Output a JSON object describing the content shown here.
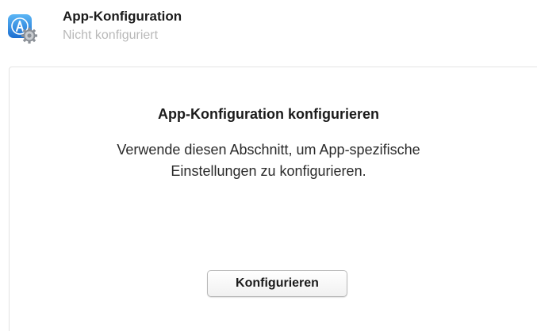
{
  "header": {
    "icon": "app-store-gear-icon",
    "title": "App-Konfiguration",
    "subtitle": "Nicht konfiguriert"
  },
  "panel": {
    "title": "App-Konfiguration konfigurieren",
    "description_line1": "Verwende diesen Abschnitt, um App-spezifische",
    "description_line2": "Einstellungen zu konfigurieren.",
    "button_label": "Konfigurieren"
  },
  "colors": {
    "icon_blue": "#2f8fe0",
    "subtitle_gray": "#b9b9b9",
    "panel_border": "#e3e3e3"
  }
}
